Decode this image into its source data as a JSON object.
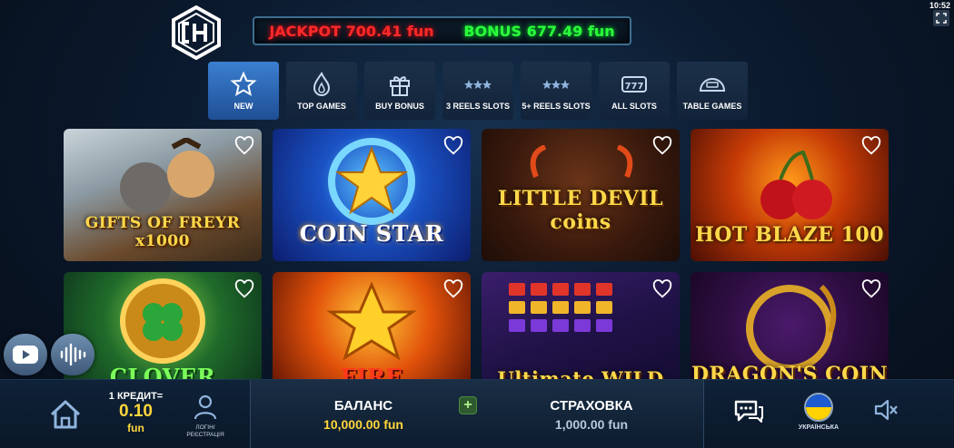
{
  "header": {
    "jackpot_text": "JACKPOT 700.41 fun",
    "bonus_text": "BONUS 677.49 fun",
    "clock": "10:52"
  },
  "categories": [
    {
      "label": "NEW",
      "icon": "star-icon",
      "active": true
    },
    {
      "label": "TOP GAMES",
      "icon": "flame-icon",
      "active": false
    },
    {
      "label": "BUY BONUS",
      "icon": "gift-icon",
      "active": false
    },
    {
      "label": "3 REELS SLOTS",
      "icon": "three-stars-icon",
      "active": false
    },
    {
      "label": "5+ REELS SLOTS",
      "icon": "three-stars-icon",
      "active": false
    },
    {
      "label": "ALL SLOTS",
      "icon": "slot-777-icon",
      "active": false
    },
    {
      "label": "TABLE GAMES",
      "icon": "table-game-icon",
      "active": false
    }
  ],
  "games": [
    {
      "title": "GIFTS OF FREYR x1000"
    },
    {
      "title": "COIN STAR"
    },
    {
      "title": "LITTLE DEVIL coins"
    },
    {
      "title": "HOT BLAZE 100"
    },
    {
      "title": "CLOVER"
    },
    {
      "title": "FIRE"
    },
    {
      "title": "Ultimate WILD"
    },
    {
      "title": "DRAGON'S COIN"
    }
  ],
  "bottom_bar": {
    "credit_label": "1 КРЕДИТ=",
    "credit_value": "0.10",
    "credit_unit": "fun",
    "login_label": "ЛОГІН/ РЕЄСТРАЦІЯ",
    "balance_label": "БАЛАНС",
    "balance_value": "10,000.00 fun",
    "insurance_label": "СТРАХОВКА",
    "insurance_value": "1,000.00 fun",
    "language_label": "УКРАЇНСЬКА",
    "plus_symbol": "+"
  },
  "colors": {
    "jackpot": "#ff2a2a",
    "bonus": "#2cff3c",
    "credit": "#ffd63a",
    "active_tab": "#3b7fd0"
  }
}
